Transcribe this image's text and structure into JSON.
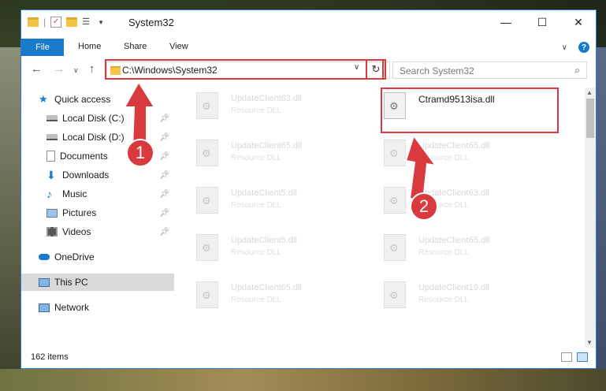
{
  "window": {
    "title": "System32"
  },
  "ribbon": {
    "tabs": [
      "File",
      "Home",
      "Share",
      "View"
    ],
    "help": "?"
  },
  "address": {
    "path": "C:\\Windows\\System32"
  },
  "search": {
    "placeholder": "Search System32"
  },
  "sidebar": {
    "items": [
      {
        "label": "Quick access",
        "icon": "star-icon",
        "pinned": false
      },
      {
        "label": "Local Disk (C:)",
        "icon": "drive-icon",
        "pinned": true
      },
      {
        "label": "Local Disk (D:)",
        "icon": "drive-icon",
        "pinned": true
      },
      {
        "label": "Documents",
        "icon": "documents-icon",
        "pinned": true
      },
      {
        "label": "Downloads",
        "icon": "download-icon",
        "pinned": true
      },
      {
        "label": "Music",
        "icon": "music-icon",
        "pinned": true
      },
      {
        "label": "Pictures",
        "icon": "pictures-icon",
        "pinned": true
      },
      {
        "label": "Videos",
        "icon": "video-icon",
        "pinned": true
      },
      {
        "label": "OneDrive",
        "icon": "cloud-icon",
        "pinned": false
      },
      {
        "label": "This PC",
        "icon": "pc-icon",
        "pinned": false,
        "selected": true
      },
      {
        "label": "Network",
        "icon": "network-icon",
        "pinned": false
      }
    ]
  },
  "files": {
    "left": [
      {
        "name": "UpdateClient63.dll",
        "type": "Resource DLL"
      },
      {
        "name": "UpdateClient65.dll",
        "type": "Resource DLL"
      },
      {
        "name": "UpdateClient5.dll",
        "type": "Resource DLL"
      },
      {
        "name": "UpdateClient5.dll",
        "type": "Resource DLL"
      },
      {
        "name": "UpdateClient65.dll",
        "type": "Resource DLL"
      }
    ],
    "right": [
      {
        "name": "Ctramd9513isa.dll",
        "type": ""
      },
      {
        "name": "UpdateClient65.dll",
        "type": "Resource DLL"
      },
      {
        "name": "UpdateClient63.dll",
        "type": "Resource DLL"
      },
      {
        "name": "UpdateClient65.dll",
        "type": "Resource DLL"
      },
      {
        "name": "UpdateClient19.dll",
        "type": "Resource DLL"
      }
    ]
  },
  "status": {
    "count": "162 items"
  },
  "annotations": {
    "badge1": "1",
    "badge2": "2"
  },
  "colors": {
    "accent": "#1979ca",
    "annotation": "#d93a3e"
  }
}
